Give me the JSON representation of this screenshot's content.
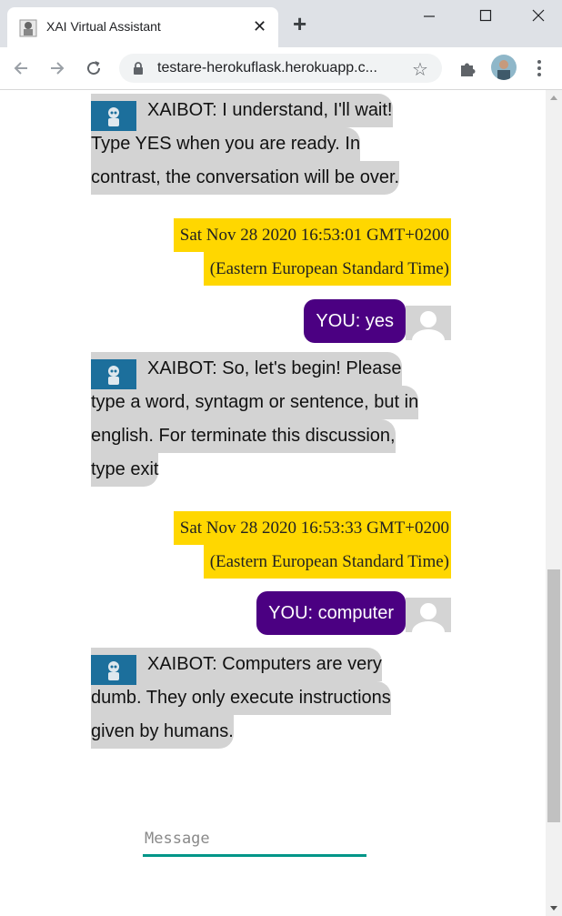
{
  "browser": {
    "tab_title": "XAI Virtual Assistant",
    "url": "testare-herokuflask.herokuapp.c..."
  },
  "chat": {
    "messages": [
      {
        "sender": "bot",
        "lines": [
          "XAIBOT: I understand, I'll wait!",
          "Type YES when you are ready. In",
          "contrast, the conversation will be over."
        ]
      },
      {
        "sender": "timestamp",
        "lines": [
          "Sat Nov 28 2020 16:53:01 GMT+0200",
          "(Eastern European Standard Time)"
        ]
      },
      {
        "sender": "user",
        "text": "YOU: yes"
      },
      {
        "sender": "bot",
        "lines": [
          "XAIBOT: So, let's begin! Please",
          "type a word, syntagm or sentence, but in",
          "english. For terminate this discussion,",
          "type exit"
        ]
      },
      {
        "sender": "timestamp",
        "lines": [
          "Sat Nov 28 2020 16:53:33 GMT+0200",
          "(Eastern European Standard Time)"
        ]
      },
      {
        "sender": "user",
        "text": "YOU: computer"
      },
      {
        "sender": "bot",
        "lines": [
          "XAIBOT: Computers are very",
          "dumb. They only execute instructions",
          "given by humans."
        ]
      }
    ]
  },
  "composer": {
    "placeholder": "Message",
    "value": ""
  },
  "colors": {
    "bot_bubble": "#d3d3d3",
    "user_bubble": "#4b0082",
    "timestamp_bg": "#ffd700",
    "input_underline": "#009688"
  },
  "icons": {
    "back": "arrow-left-icon",
    "forward": "arrow-right-icon",
    "reload": "reload-icon",
    "lock": "lock-icon",
    "bookmark": "star-icon",
    "extensions": "puzzle-icon",
    "menu": "kebab-menu-icon"
  }
}
